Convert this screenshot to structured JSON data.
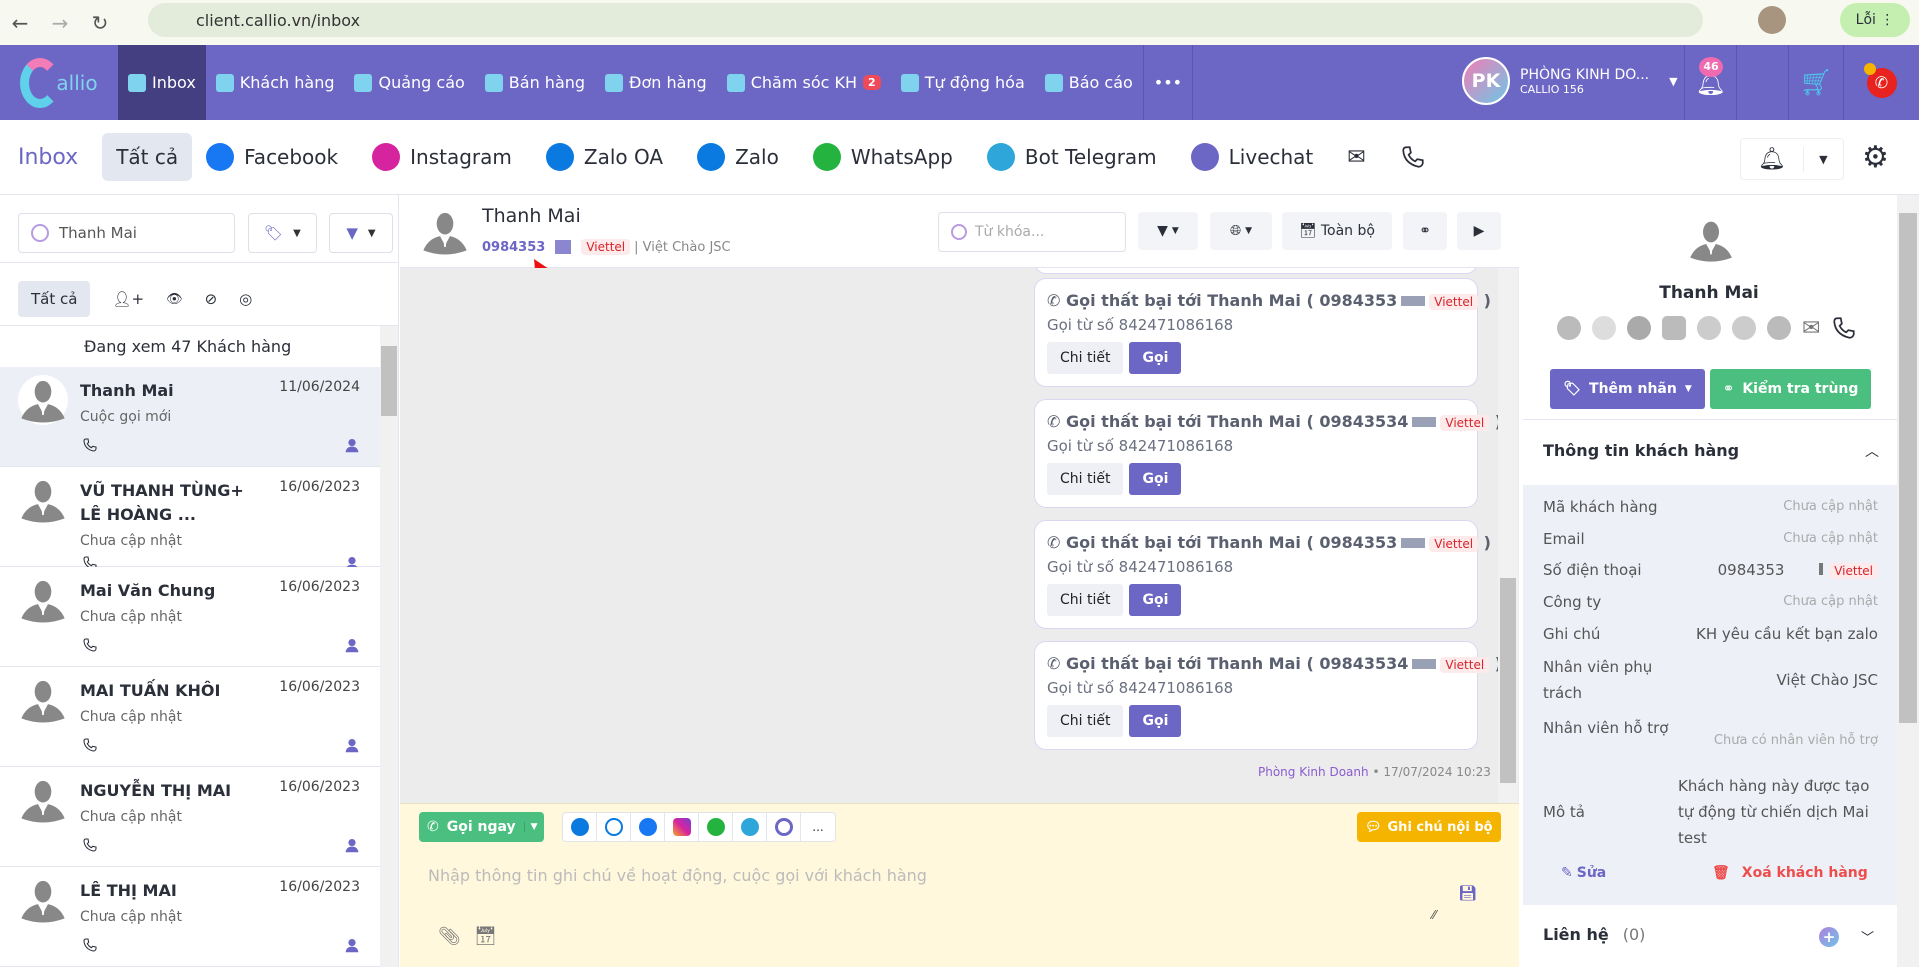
{
  "browser": {
    "url": "client.callio.vn/inbox",
    "profile_label": "Lỗi"
  },
  "topnav": {
    "logo": "Callio",
    "items": [
      {
        "label": "Inbox",
        "active": true
      },
      {
        "label": "Khách hàng"
      },
      {
        "label": "Quảng cáo"
      },
      {
        "label": "Bán hàng"
      },
      {
        "label": "Đơn hàng"
      },
      {
        "label": "Chăm sóc KH",
        "badge": "2"
      },
      {
        "label": "Tự động hóa"
      },
      {
        "label": "Báo cáo"
      }
    ],
    "more": "•••",
    "account": {
      "initials": "PK",
      "name": "PHÒNG KINH DO...",
      "sub": "CALLIO 156"
    },
    "notif_count": "46"
  },
  "channels": {
    "title": "Inbox",
    "items": [
      {
        "label": "Tất cả",
        "icon": "all",
        "active": true
      },
      {
        "label": "Facebook",
        "icon": "facebook-icon",
        "color": "#1877f2"
      },
      {
        "label": "Instagram",
        "icon": "instagram-icon",
        "color": "#d6249f"
      },
      {
        "label": "Zalo OA",
        "icon": "zalo-oa-icon",
        "color": "#0a7ae0"
      },
      {
        "label": "Zalo",
        "icon": "zalo-icon",
        "color": "#0a7ae0"
      },
      {
        "label": "WhatsApp",
        "icon": "whatsapp-icon",
        "color": "#25b340"
      },
      {
        "label": "Bot Telegram",
        "icon": "telegram-icon",
        "color": "#2ea6da"
      },
      {
        "label": "Livechat",
        "icon": "livechat-icon",
        "color": "#6c66c4"
      }
    ]
  },
  "left": {
    "search_value": "Thanh Mai",
    "filter_tab": "Tất cả",
    "viewing": "Đang xem 47 Khách hàng",
    "contacts": [
      {
        "name": "Thanh Mai",
        "date": "11/06/2024",
        "status": "Cuộc gọi mới",
        "selected": true
      },
      {
        "name": "VŨ THANH TÙNG+ LÊ HOÀNG ...",
        "date": "16/06/2023",
        "status": "Chưa cập nhật"
      },
      {
        "name": "Mai Văn Chung",
        "date": "16/06/2023",
        "status": "Chưa cập nhật"
      },
      {
        "name": "MAI TUẤN KHÔI",
        "date": "16/06/2023",
        "status": "Chưa cập nhật"
      },
      {
        "name": "NGUYỄN THỊ MAI",
        "date": "16/06/2023",
        "status": "Chưa cập nhật"
      },
      {
        "name": "LÊ THỊ MAI",
        "date": "16/06/2023",
        "status": "Chưa cập nhật"
      }
    ]
  },
  "chat": {
    "name": "Thanh Mai",
    "phone": "0984353",
    "carrier": "Viettel",
    "company": "| Việt Chào JSC",
    "search_placeholder": "Từ khóa...",
    "range_label": "Toàn bộ",
    "messages": [
      {
        "title": "Gọi thất bại tới Thanh Mai ( 0984353",
        "carrier": "Viettel",
        "close": ")",
        "from": "Gọi từ số 842471086168"
      },
      {
        "title": "Gọi thất bại tới Thanh Mai ( 09843534",
        "carrier": "Viettel",
        "close": ")",
        "from": "Gọi từ số 842471086168"
      },
      {
        "title": "Gọi thất bại tới Thanh Mai ( 0984353",
        "carrier": "Viettel",
        "close": ")",
        "from": "Gọi từ số 842471086168"
      },
      {
        "title": "Gọi thất bại tới Thanh Mai ( 09843534",
        "carrier": "Viettel",
        "close": ")",
        "from": "Gọi từ số 842471086168"
      }
    ],
    "detail_label": "Chi tiết",
    "call_label": "Gọi",
    "footer_sender": "Phòng Kinh Doanh",
    "footer_time": "• 17/07/2024 10:23"
  },
  "composer": {
    "call_now": "Gọi ngay",
    "more": "...",
    "internal_note": "Ghi chú nội bộ",
    "placeholder": "Nhập thông tin ghi chú về hoạt động, cuộc gọi với khách hàng"
  },
  "right": {
    "name": "Thanh Mai",
    "add_tag": "Thêm nhãn",
    "check_dup": "Kiểm tra trùng",
    "section": "Thông tin khách hàng",
    "fields": [
      {
        "label": "Mã khách hàng",
        "value": "Chưa cập nhật",
        "muted": true
      },
      {
        "label": "Email",
        "value": "Chưa cập nhật",
        "muted": true
      },
      {
        "label": "Số điện thoại",
        "value": "0984353",
        "carrier": "Viettel"
      },
      {
        "label": "Công ty",
        "value": "Chưa cập nhật",
        "muted": true
      },
      {
        "label": "Ghi chú",
        "value": "KH yêu cầu kết bạn zalo"
      },
      {
        "label": "Nhân viên phụ trách",
        "value": "Việt Chào JSC"
      },
      {
        "label": "Nhân viên hỗ trợ",
        "value": "Chưa có nhân viên hỗ trợ",
        "muted": true
      },
      {
        "label": "Mô tả",
        "value": "Khách hàng này được tạo tự động từ chiến dịch Mai test"
      }
    ],
    "edit": "Sửa",
    "delete": "Xoá khách hàng",
    "contacts_label": "Liên hệ",
    "contacts_count": "(0)"
  },
  "colors": {
    "brand": "#6c66c4",
    "green": "#4abf7f",
    "orange": "#f5b400",
    "danger": "#ee4d4d"
  }
}
